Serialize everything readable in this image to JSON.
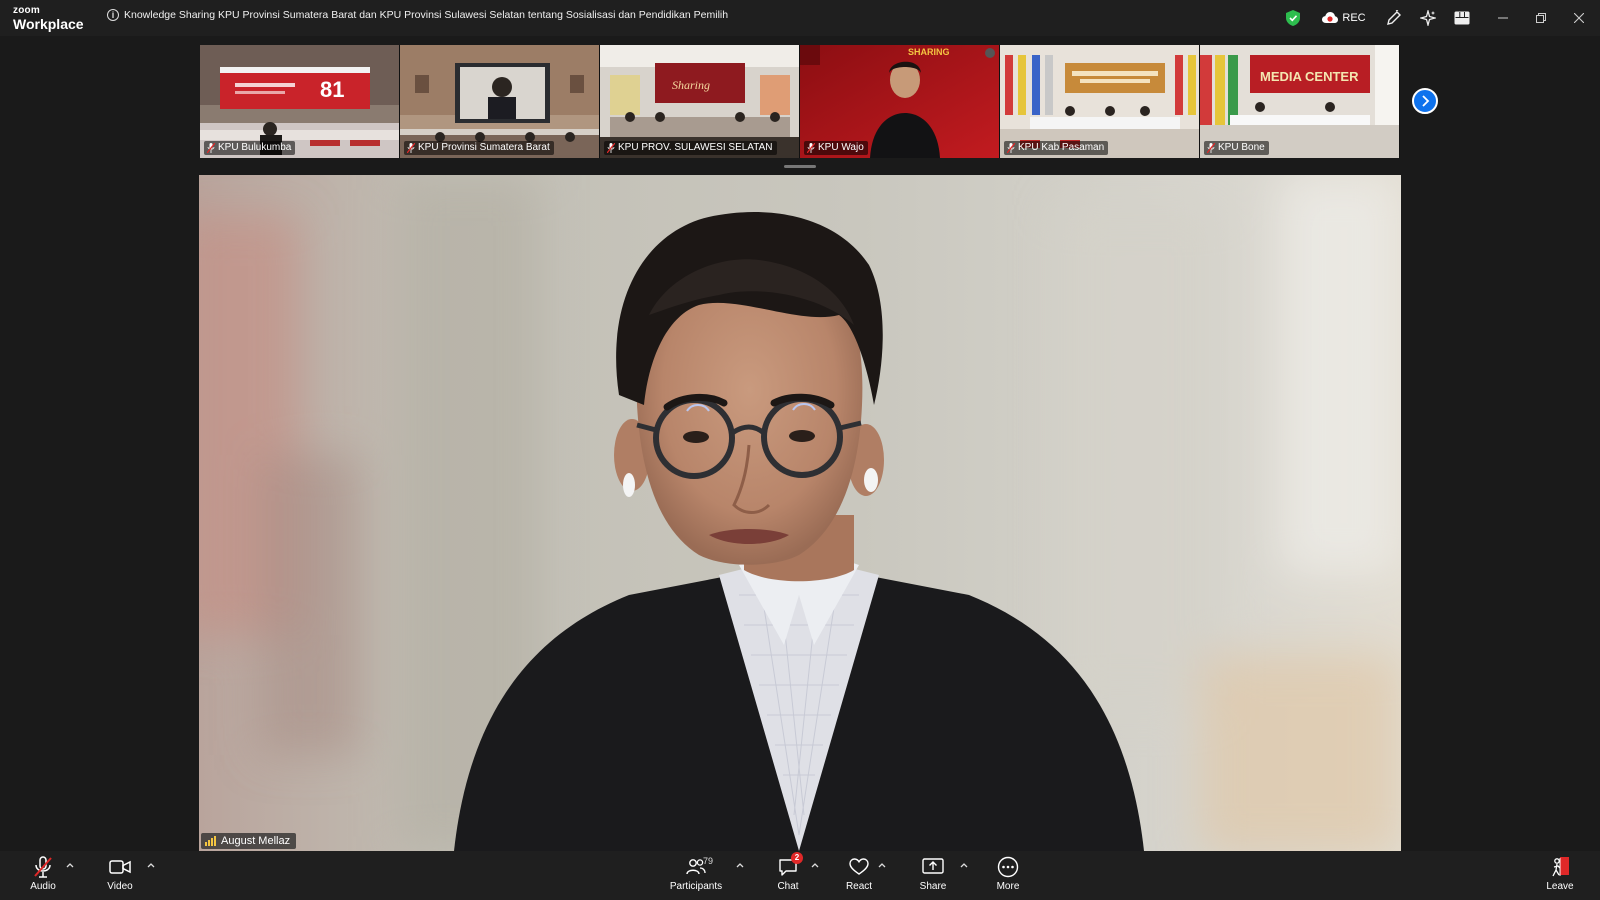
{
  "app": {
    "logo_small": "zoom",
    "logo_big": "Workplace",
    "meeting_title": "Knowledge Sharing KPU Provinsi Sumatera Barat dan KPU Provinsi Sulawesi Selatan tentang Sosialisasi dan Pendidikan Pemilih",
    "rec_label": "REC"
  },
  "participants_strip": [
    {
      "name": "KPU Bulukumba"
    },
    {
      "name": "KPU Provinsi Sumatera Barat"
    },
    {
      "name": "KPU PROV. SULAWESI SELATAN"
    },
    {
      "name": "KPU Wajo"
    },
    {
      "name": "KPU Kab Pasaman"
    },
    {
      "name": "KPU Bone"
    }
  ],
  "speaker": {
    "name": "August Mellaz"
  },
  "toolbar": {
    "audio": "Audio",
    "video": "Video",
    "participants": "Participants",
    "participants_count": "79",
    "chat": "Chat",
    "chat_badge": "2",
    "react": "React",
    "share": "Share",
    "more": "More",
    "leave": "Leave"
  },
  "colors": {
    "accent": "#0e72ed",
    "shield": "#2dbd4e",
    "badge": "#e02828",
    "mic_muted": "#e02828"
  }
}
